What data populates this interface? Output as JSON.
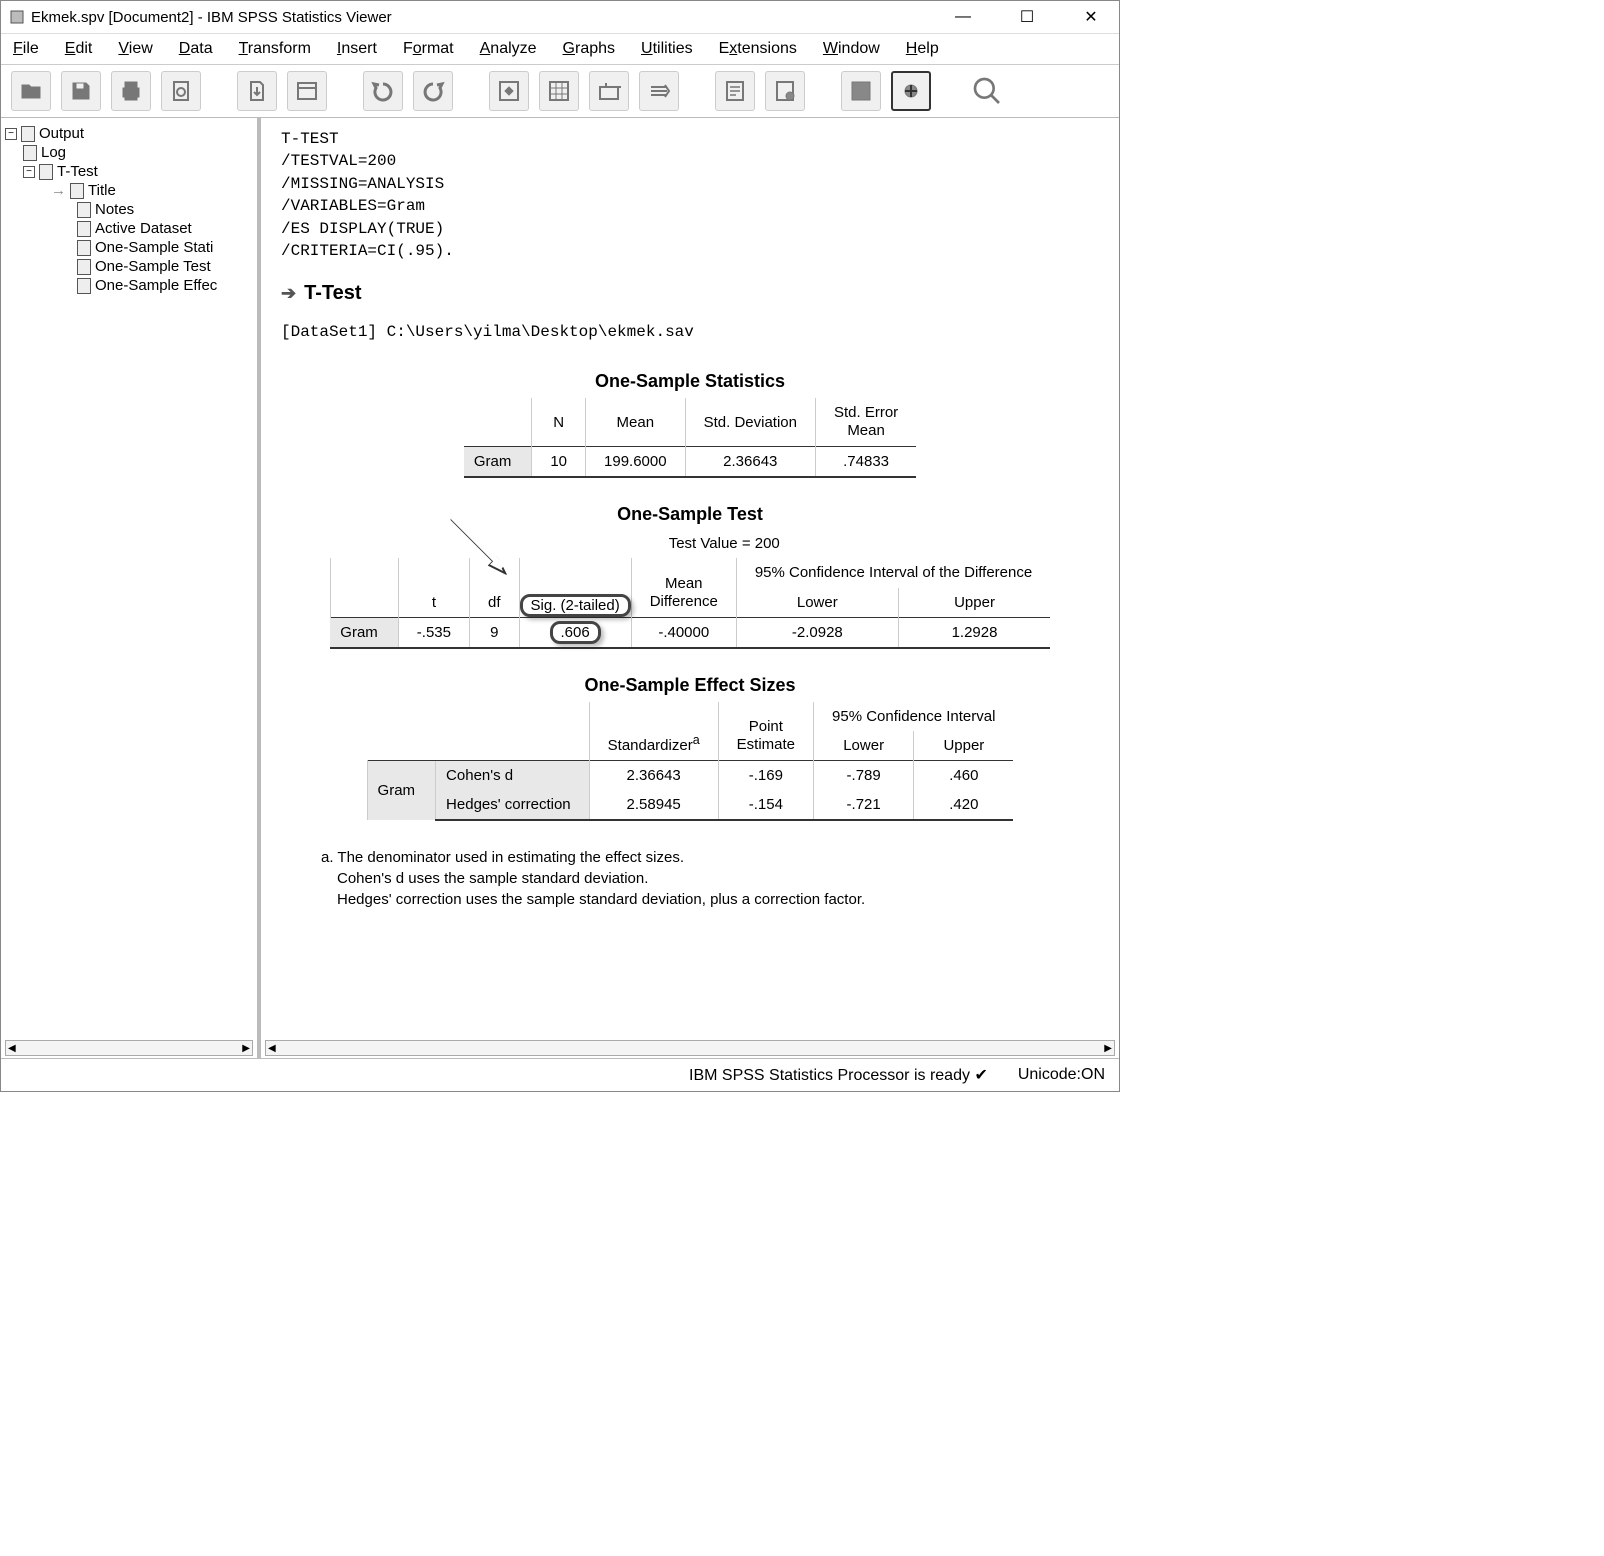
{
  "title": "Ekmek.spv [Document2] - IBM SPSS Statistics Viewer",
  "menus": [
    "File",
    "Edit",
    "View",
    "Data",
    "Transform",
    "Insert",
    "Format",
    "Analyze",
    "Graphs",
    "Utilities",
    "Extensions",
    "Window",
    "Help"
  ],
  "outline": {
    "root": "Output",
    "log": "Log",
    "ttest": "T-Test",
    "children": [
      "Title",
      "Notes",
      "Active Dataset",
      "One-Sample Stati",
      "One-Sample Test",
      "One-Sample Effec"
    ]
  },
  "syntax": {
    "l1": "T-TEST",
    "l2": "  /TESTVAL=200",
    "l3": "  /MISSING=ANALYSIS",
    "l4": "  /VARIABLES=Gram",
    "l5": "  /ES DISPLAY(TRUE)",
    "l6": "  /CRITERIA=CI(.95)."
  },
  "section": "T-Test",
  "dataset": "[DataSet1] C:\\Users\\yilma\\Desktop\\ekmek.sav",
  "tbl1": {
    "title": "One-Sample Statistics",
    "cols": [
      "N",
      "Mean",
      "Std. Deviation",
      "Std. Error Mean"
    ],
    "rowlabel": "Gram",
    "vals": [
      "10",
      "199.6000",
      "2.36643",
      ".74833"
    ]
  },
  "tbl2": {
    "title": "One-Sample Test",
    "testval": "Test Value = 200",
    "ci_label": "95% Confidence Interval of the Difference",
    "cols": [
      "t",
      "df",
      "Sig. (2-tailed)",
      "Mean Difference",
      "Lower",
      "Upper"
    ],
    "rowlabel": "Gram",
    "vals": [
      "-.535",
      "9",
      ".606",
      "-.40000",
      "-2.0928",
      "1.2928"
    ]
  },
  "tbl3": {
    "title": "One-Sample Effect Sizes",
    "ci_label": "95% Confidence Interval",
    "hdr_std": "Standardizer",
    "hdr_pe": "Point Estimate",
    "hdr_lo": "Lower",
    "hdr_up": "Upper",
    "rowlabel": "Gram",
    "r1_name": "Cohen's d",
    "r1": [
      "2.36643",
      "-.169",
      "-.789",
      ".460"
    ],
    "r2_name": "Hedges' correction",
    "r2": [
      "2.58945",
      "-.154",
      "-.721",
      ".420"
    ],
    "foot_a": "a. The denominator used in estimating the effect sizes.",
    "foot_b": "Cohen's d uses the sample standard deviation.",
    "foot_c": "Hedges' correction uses the sample standard deviation, plus a correction factor."
  },
  "status": {
    "ready": "IBM SPSS Statistics Processor is ready",
    "unicode": "Unicode:ON"
  }
}
